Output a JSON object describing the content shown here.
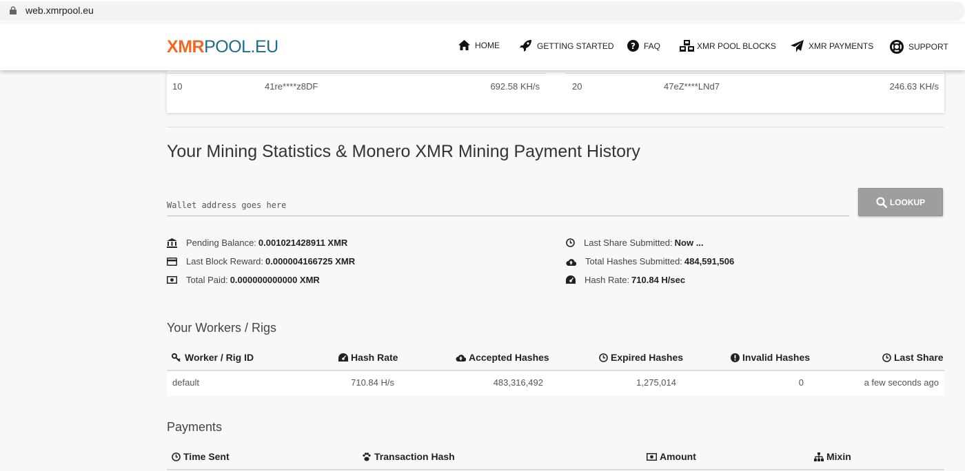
{
  "browser": {
    "url": "web.xmrpool.eu"
  },
  "logo": {
    "x": "X",
    "m": "M",
    "r": "R",
    "rest": "POOL.EU"
  },
  "nav": [
    {
      "label": "HOME",
      "icon": "home-icon"
    },
    {
      "label": "GETTING STARTED",
      "icon": "rocket-icon"
    },
    {
      "label": "FAQ",
      "icon": "question-circle-icon"
    },
    {
      "label": "XMR POOL BLOCKS",
      "icon": "cubes-icon"
    },
    {
      "label": "XMR PAYMENTS",
      "icon": "paper-plane-icon"
    },
    {
      "label": "SUPPORT",
      "icon": "life-ring-icon"
    }
  ],
  "top_miners": {
    "left": {
      "rank": "10",
      "address": "41re****z8DF",
      "hashrate": "692.58 KH/s"
    },
    "right": {
      "rank": "20",
      "address": "47eZ****LNd7",
      "hashrate": "246.63 KH/s"
    }
  },
  "main_heading": "Your Mining Statistics & Monero XMR Mining Payment History",
  "wallet": {
    "placeholder": "Wallet address goes here"
  },
  "lookup_label": "LOOKUP",
  "stats": {
    "pending_label": "Pending Balance:",
    "pending_value": "0.001021428911 XMR",
    "last_reward_label": "Last Block Reward:",
    "last_reward_value": "0.000004166725 XMR",
    "total_paid_label": "Total Paid:",
    "total_paid_value": "0.000000000000 XMR",
    "last_share_label": "Last Share Submitted:",
    "last_share_value": "Now ...",
    "total_hashes_label": "Total Hashes Submitted:",
    "total_hashes_value": "484,591,506",
    "hash_rate_label": "Hash Rate:",
    "hash_rate_value": "710.84 H/sec"
  },
  "workers": {
    "heading": "Your Workers / Rigs",
    "columns": [
      "Worker / Rig ID",
      "Hash Rate",
      "Accepted Hashes",
      "Expired Hashes",
      "Invalid Hashes",
      "Last Share"
    ],
    "rows": [
      [
        "default",
        "710.84 H/s",
        "483,316,492",
        "1,275,014",
        "0",
        "a few seconds ago"
      ]
    ]
  },
  "payments": {
    "heading": "Payments",
    "columns": [
      "Time Sent",
      "Transaction Hash",
      "Amount",
      "Mixin"
    ]
  }
}
